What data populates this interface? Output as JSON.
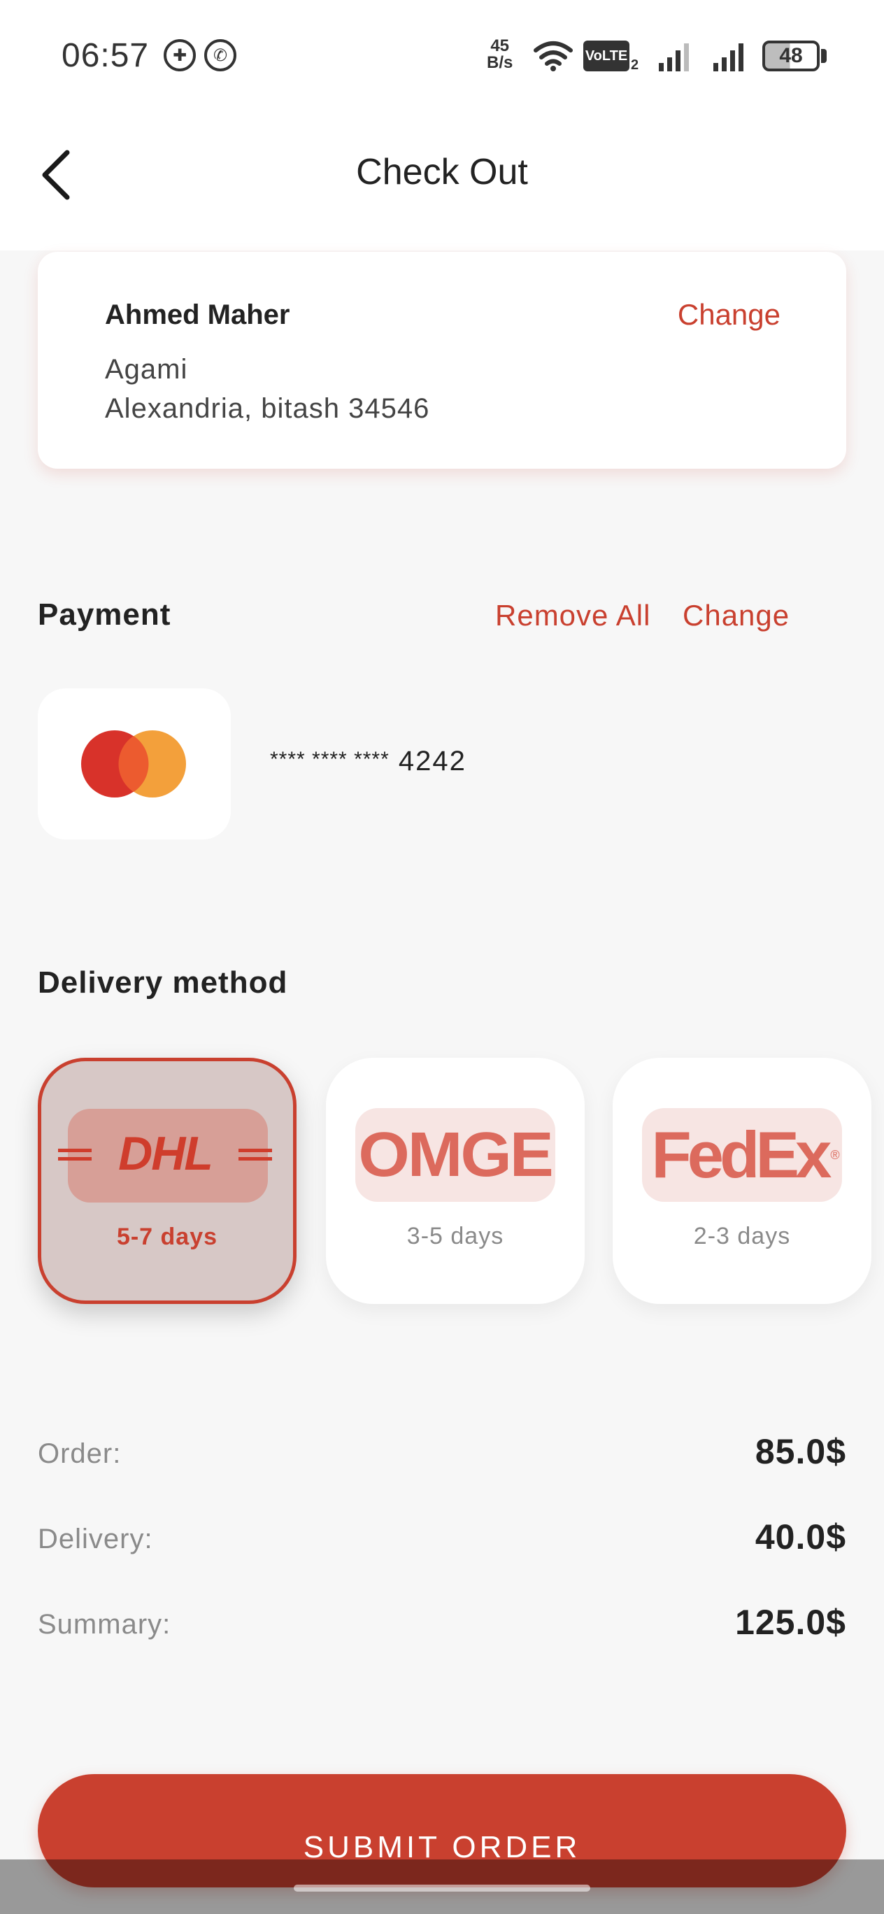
{
  "status_bar": {
    "time": "06:57",
    "net_speed_value": "45",
    "net_speed_unit": "B/s",
    "volte": "VoLTE",
    "volte_sub": "2",
    "battery": "48"
  },
  "header": {
    "title": "Check Out"
  },
  "address": {
    "name": "Ahmed Maher",
    "change_label": "Change",
    "line1": "Agami",
    "line2": "Alexandria, bitash 34546"
  },
  "payment": {
    "title": "Payment",
    "remove_all_label": "Remove All",
    "change_label": "Change",
    "card_mask": "**** **** ****",
    "card_last4": "4242"
  },
  "delivery": {
    "title": "Delivery method",
    "options": [
      {
        "name": "DHL",
        "days": "5-7 days",
        "selected": true
      },
      {
        "name": "OMGE",
        "days": "3-5 days",
        "selected": false
      },
      {
        "name": "FedEx",
        "days": "2-3 days",
        "selected": false
      }
    ]
  },
  "summary": {
    "order_label": "Order:",
    "order_value": "85.0$",
    "delivery_label": "Delivery:",
    "delivery_value": "40.0$",
    "summary_label": "Summary:",
    "summary_value": "125.0$"
  },
  "actions": {
    "submit_label": "SUBMIT ORDER"
  },
  "colors": {
    "accent": "#c9402f",
    "background": "#f7f7f7",
    "mastercard_red": "#d8322a",
    "mastercard_orange": "#f3a03b"
  }
}
